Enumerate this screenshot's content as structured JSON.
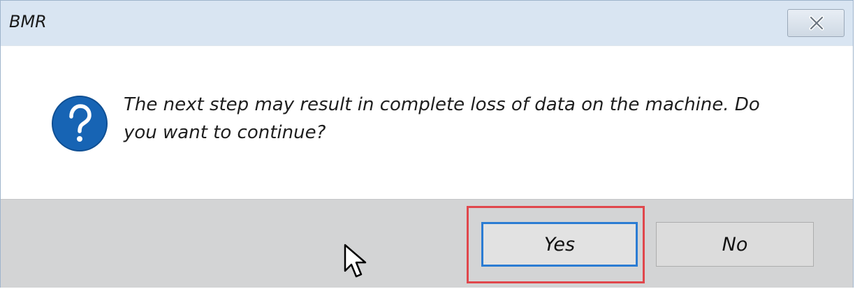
{
  "window": {
    "title": "BMR",
    "close_icon": "close-x-icon"
  },
  "message": {
    "icon": "question-mark-icon",
    "text": "The next step may result in complete loss of data on the machine. Do you want to continue?"
  },
  "buttons": {
    "yes_label": "Yes",
    "no_label": "No"
  },
  "colors": {
    "titlebar": "#d9e5f2",
    "footer": "#d3d4d5",
    "icon_blue": "#1764b4",
    "focus_border": "#2b7cd3",
    "highlight": "#e0474c"
  }
}
